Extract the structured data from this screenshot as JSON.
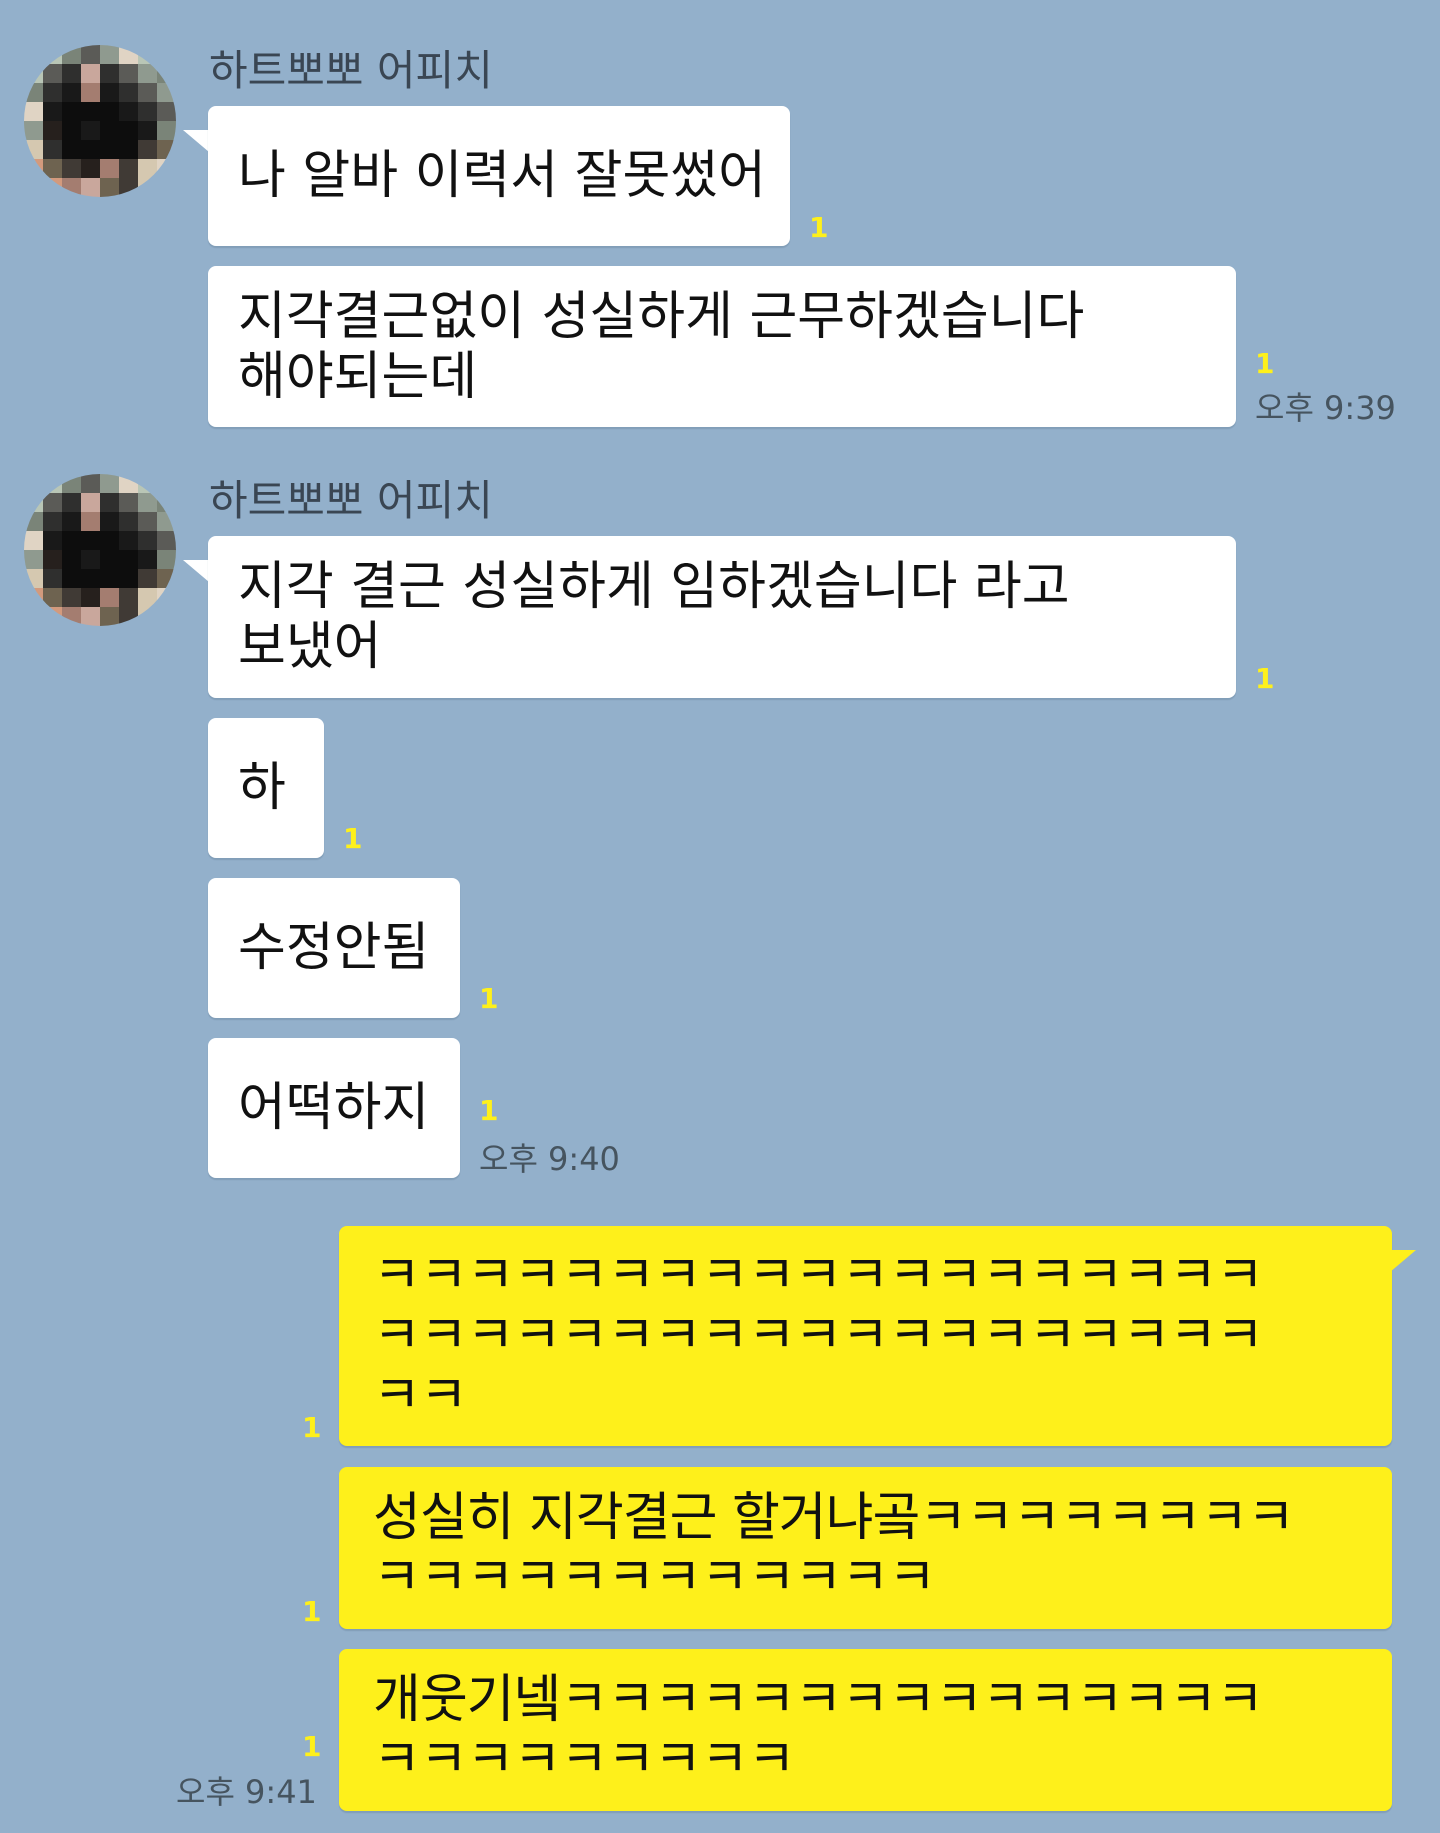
{
  "sender_name": "하트뽀뽀 어피치",
  "messages_received_1": {
    "m1": "나 알바 이력서 잘못썼어",
    "m1_unread": "1",
    "m2_line1": "지각결근없이 성실하게 근무하겠습니다",
    "m2_line2": "해야되는데",
    "m2_unread": "1",
    "time": "오후 9:39"
  },
  "messages_received_2": {
    "m1_line1": "지각 결근 성실하게 임하겠습니다 라고",
    "m1_line2": "보냈어",
    "m1_unread": "1",
    "m2": "하",
    "m2_unread": "1",
    "m3": "수정안됨",
    "m3_unread": "1",
    "m4": "어떡하지",
    "m4_unread": "1",
    "time": "오후 9:40"
  },
  "messages_sent": {
    "m1_line1": "ㅋㅋㅋㅋㅋㅋㅋㅋㅋㅋㅋㅋㅋㅋㅋㅋㅋㅋㅋ",
    "m1_line2": "ㅋㅋㅋㅋㅋㅋㅋㅋㅋㅋㅋㅋㅋㅋㅋㅋㅋㅋㅋ",
    "m1_line3": "ㅋㅋ",
    "m1_unread": "1",
    "m2_line1": "성실히 지각결근 할거냐곸ㅋㅋㅋㅋㅋㅋㅋㅋ",
    "m2_line2": "ㅋㅋㅋㅋㅋㅋㅋㅋㅋㅋㅋㅋ",
    "m2_unread": "1",
    "m3_line1": "개웃기넼ㅋㅋㅋㅋㅋㅋㅋㅋㅋㅋㅋㅋㅋㅋㅋ",
    "m3_line2": "ㅋㅋㅋㅋㅋㅋㅋㅋㅋ",
    "m3_unread": "1",
    "time": "오후 9:41"
  },
  "colors": {
    "background": "#93b0cb",
    "received_bubble": "#ffffff",
    "sent_bubble": "#fef01b",
    "unread_count": "#fef01b"
  }
}
